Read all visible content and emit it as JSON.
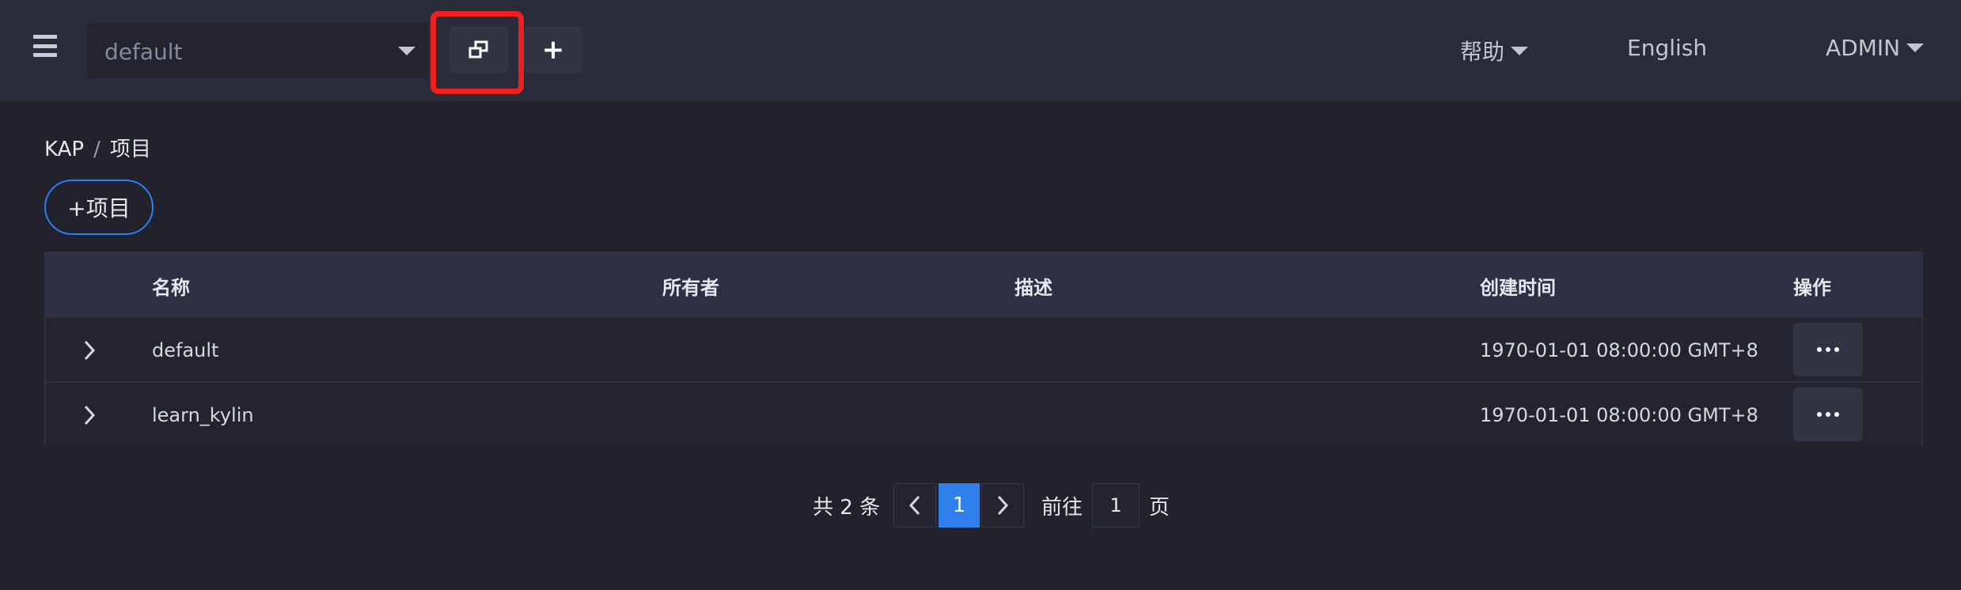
{
  "header": {
    "project_select": {
      "value": "default"
    },
    "help_label": "帮助",
    "language_label": "English",
    "user_label": "ADMIN"
  },
  "breadcrumb": {
    "root": "KAP",
    "separator": "/",
    "current": "项目"
  },
  "add_project_label": "+项目",
  "table": {
    "columns": [
      "名称",
      "所有者",
      "描述",
      "创建时间",
      "操作"
    ],
    "rows": [
      {
        "name": "default",
        "owner": "",
        "description": "",
        "created": "1970-01-01 08:00:00 GMT+8"
      },
      {
        "name": "learn_kylin",
        "owner": "",
        "description": "",
        "created": "1970-01-01 08:00:00 GMT+8"
      }
    ]
  },
  "pagination": {
    "total_label": "共 2 条",
    "current_page": "1",
    "goto_label": "前往",
    "goto_value": "1",
    "page_suffix": "页"
  },
  "colors": {
    "accent": "#2f80ed",
    "highlight": "#f01f1f",
    "background": "#21222d",
    "topbar": "#292b38"
  },
  "icons": {
    "menu": "hamburger-icon",
    "switch": "window-switch-icon",
    "add": "plus-icon",
    "expand": "chevron-right-icon",
    "more": "ellipsis-icon",
    "prev": "chevron-left-icon",
    "next": "chevron-right-icon"
  }
}
